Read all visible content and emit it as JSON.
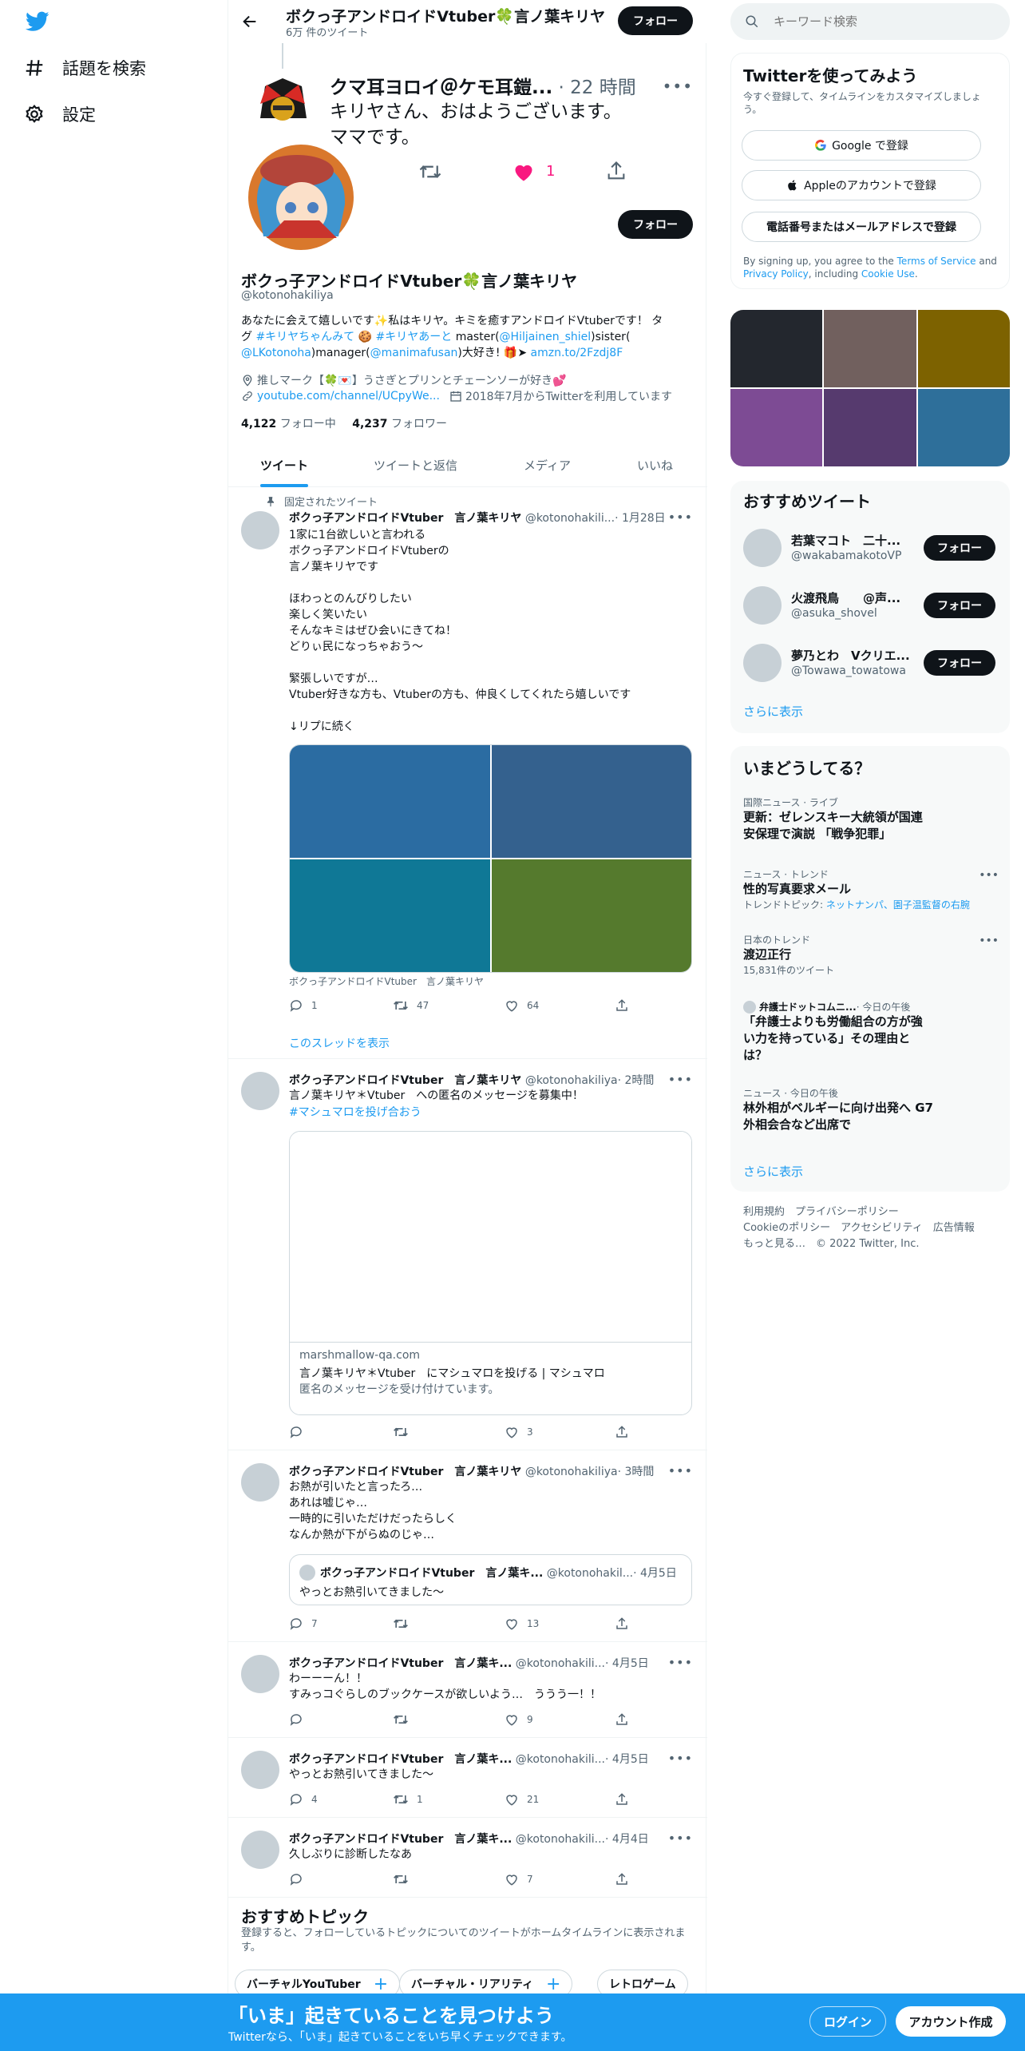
{
  "nav": {
    "explore": "話題を検索",
    "settings": "設定"
  },
  "header": {
    "name": "ボクっ子アンドロイドVtuber🍀言ノ葉キリヤ",
    "count": "6万 件のツイート",
    "follow": "フォロー"
  },
  "overlay_tweet": {
    "name": "クマ耳ヨロイ＠ケモ耳鎧...",
    "time": "· 22 時間",
    "text": "キリヤさん、おはようございます。\nママです。",
    "likes": "1"
  },
  "profile": {
    "follow": "フォロー",
    "name": "ボクっ子アンドロイドVtuber🍀言ノ葉キリヤ",
    "handle": "@kotonohakiliya",
    "bio_1": "あなたに会えて嬉しいです✨私はキリヤ。キミを癒すアンドロイドVtuberです！ タ",
    "bio_2a": "グ ",
    "bio_2b": "#キリヤちゃんみて",
    "bio_2c": " 🍪 ",
    "bio_2d": "#キリヤあーと",
    "bio_2e": " master(",
    "bio_2f": "@Hiljainen_shiel",
    "bio_2g": ")sister(",
    "bio_3a": "@LKotonoha",
    "bio_3b": ")manager(",
    "bio_3c": "@manimafusan",
    "bio_3d": ")大好き! 🎁➤ ",
    "bio_3e": "amzn.to/2Fzdj8F",
    "location": "推しマーク【🍀💌】うさぎとプリンとチェーンソーが好き💕",
    "url": "youtube.com/channel/UCpyWe...",
    "joined": "2018年7月からTwitterを利用しています",
    "following_count": "4,122",
    "following_label": " フォロー中",
    "followers_count": "4,237",
    "followers_label": " フォロワー"
  },
  "tabs": [
    "ツイート",
    "ツイートと返信",
    "メディア",
    "いいね"
  ],
  "pinned": {
    "label": "固定されたツイート",
    "name": "ボクっ子アンドロイドVtuber　言ノ葉キリヤ",
    "handle": "@kotonohakili...",
    "time": "· 1月28日",
    "text": "1家に1台欲しいと言われる\nボクっ子アンドロイドVtuberの\n言ノ葉キリヤです\n\nほわっとのんびりしたい\n楽しく笑いたい\nそんなキミはぜひ会いにきてね！\nどりぃ民になっちゃおう～\n\n緊張しいですが…\nVtuber好きな方も、Vtuberの方も、仲良くしてくれたら嬉しいです\n\n↓リプに続く",
    "caption": "ボクっ子アンドロイドVtuber　言ノ葉キリヤ",
    "replies": "1",
    "retweets": "47",
    "likes": "64",
    "thread": "このスレッドを表示",
    "media_colors": [
      "#2b6ca2",
      "#34618e",
      "#0f7896",
      "#557a2d"
    ]
  },
  "tweet2": {
    "name": "ボクっ子アンドロイドVtuber　言ノ葉キリヤ",
    "handle": "@kotonohakiliya",
    "time": "· 2時間",
    "text": "言ノ葉キリヤ＊Vtuber　への匿名のメッセージを募集中！",
    "hashtag": "#マシュマロを投げ合おう",
    "card_domain": "marshmallow-qa.com",
    "card_title": "言ノ葉キリヤ＊Vtuber　にマシュマロを投げる | マシュマロ",
    "card_desc": "匿名のメッセージを受け付けています。",
    "likes": "3"
  },
  "tweet3": {
    "name": "ボクっ子アンドロイドVtuber　言ノ葉キリヤ",
    "handle": "@kotonohakiliya",
    "time": "· 3時間",
    "text": "お熱が引いたと言ったろ…\nあれは嘘じゃ…\n一時的に引いただけだったらしく\nなんか熱が下がらぬのじゃ…",
    "quote_name": "ボクっ子アンドロイドVtuber　言ノ葉キ...",
    "quote_handle": "@kotonohakil...",
    "quote_time": "· 4月5日",
    "quote_text": "やっとお熱引いてきました～",
    "replies": "7",
    "likes": "13"
  },
  "tweet4": {
    "name": "ボクっ子アンドロイドVtuber　言ノ葉キ...",
    "handle": "@kotonohakili...",
    "time": "· 4月5日",
    "text": "わーーーん！！\nすみっコぐらしのブックケースが欲しいよう…　ううう一！！",
    "likes": "9"
  },
  "tweet5": {
    "name": "ボクっ子アンドロイドVtuber　言ノ葉キ...",
    "handle": "@kotonohakili...",
    "time": "· 4月5日",
    "text": "やっとお熱引いてきました～",
    "replies": "4",
    "retweets": "1",
    "likes": "21"
  },
  "tweet6": {
    "name": "ボクっ子アンドロイドVtuber　言ノ葉キ...",
    "handle": "@kotonohakili...",
    "time": "· 4月4日",
    "text": "久しぶりに診断したなあ",
    "likes": "7"
  },
  "topics": {
    "title": "おすすめトピック",
    "desc": "登録すると、フォローしているトピックについてのツイートがホームタイムラインに表示されます。",
    "chips": [
      "バーチャルYouTuber",
      "バーチャル・リアリティ",
      "レトロゲーム"
    ]
  },
  "search": {
    "placeholder": "キーワード検索"
  },
  "signup": {
    "title": "Twitterを使ってみよう",
    "desc": "今すぐ登録して、タイムラインをカスタマイズしましょう。",
    "google": "Google で登録",
    "apple": "Appleのアカウントで登録",
    "phone": "電話番号またはメールアドレスで登録",
    "legal_1": "By signing up, you agree to the ",
    "legal_tos": "Terms of Service",
    "legal_2": " and ",
    "legal_pp": "Privacy Policy",
    "legal_3": ", including ",
    "legal_cookie": "Cookie Use",
    "legal_4": "."
  },
  "media_grid_colors": [
    "#23272e",
    "#71605e",
    "#7d6200",
    "#7d4b94",
    "#563a6e",
    "#2e6f9a"
  ],
  "who_to_follow": {
    "title": "おすすめツイート",
    "users": [
      {
        "name": "若葉マコト　二十...",
        "handle": "@wakabamakotoVP"
      },
      {
        "name": "火渡飛鳥　　@声...",
        "handle": "@asuka_shovel"
      },
      {
        "name": "夢乃とわ　Vクリエ...",
        "handle": "@Towawa_towatowa"
      }
    ],
    "follow": "フォロー",
    "more": "さらに表示"
  },
  "trends": {
    "title": "いまどうしてる？",
    "items": [
      {
        "cat": "国際ニュース · ライブ",
        "title": "更新：ゼレンスキー大統領が国連\n安保理で演説 「戦争犯罪」",
        "sub": ""
      },
      {
        "cat": "ニュース · トレンド",
        "title": "性的写真要求メール",
        "sub": "トレンドトピック: ",
        "sub_link": "ネットナンパ、園子温監督の右腕"
      },
      {
        "cat": "日本のトレンド",
        "title": "渡辺正行",
        "sub": "15,831件のツイート"
      },
      {
        "cat_source": "弁護士ドットコムニ...",
        "cat_time": " · 今日の午後",
        "title": "「弁護士よりも労働組合の方が強\nい力を持っている」その理由と\nは？",
        "sub": ""
      },
      {
        "cat": "ニュース · 今日の午後",
        "title": "林外相がベルギーに向け出発へ G7\n外相会合など出席で",
        "sub": ""
      }
    ],
    "more": "さらに表示"
  },
  "footer": {
    "l1": "利用規約　プライバシーポリシー",
    "l2": "Cookieのポリシー　アクセシビリティ　広告情報",
    "l3": "もっと見る…　© 2022 Twitter, Inc."
  },
  "banner": {
    "title": "「いま」起きていることを見つけよう",
    "sub": "Twitterなら、「いま」起きていることをいち早くチェックできます。",
    "login": "ログイン",
    "signup": "アカウント作成"
  },
  "colors": {
    "accent": "#1d9bf0",
    "like": "#f91880",
    "dark": "#0f1419"
  }
}
